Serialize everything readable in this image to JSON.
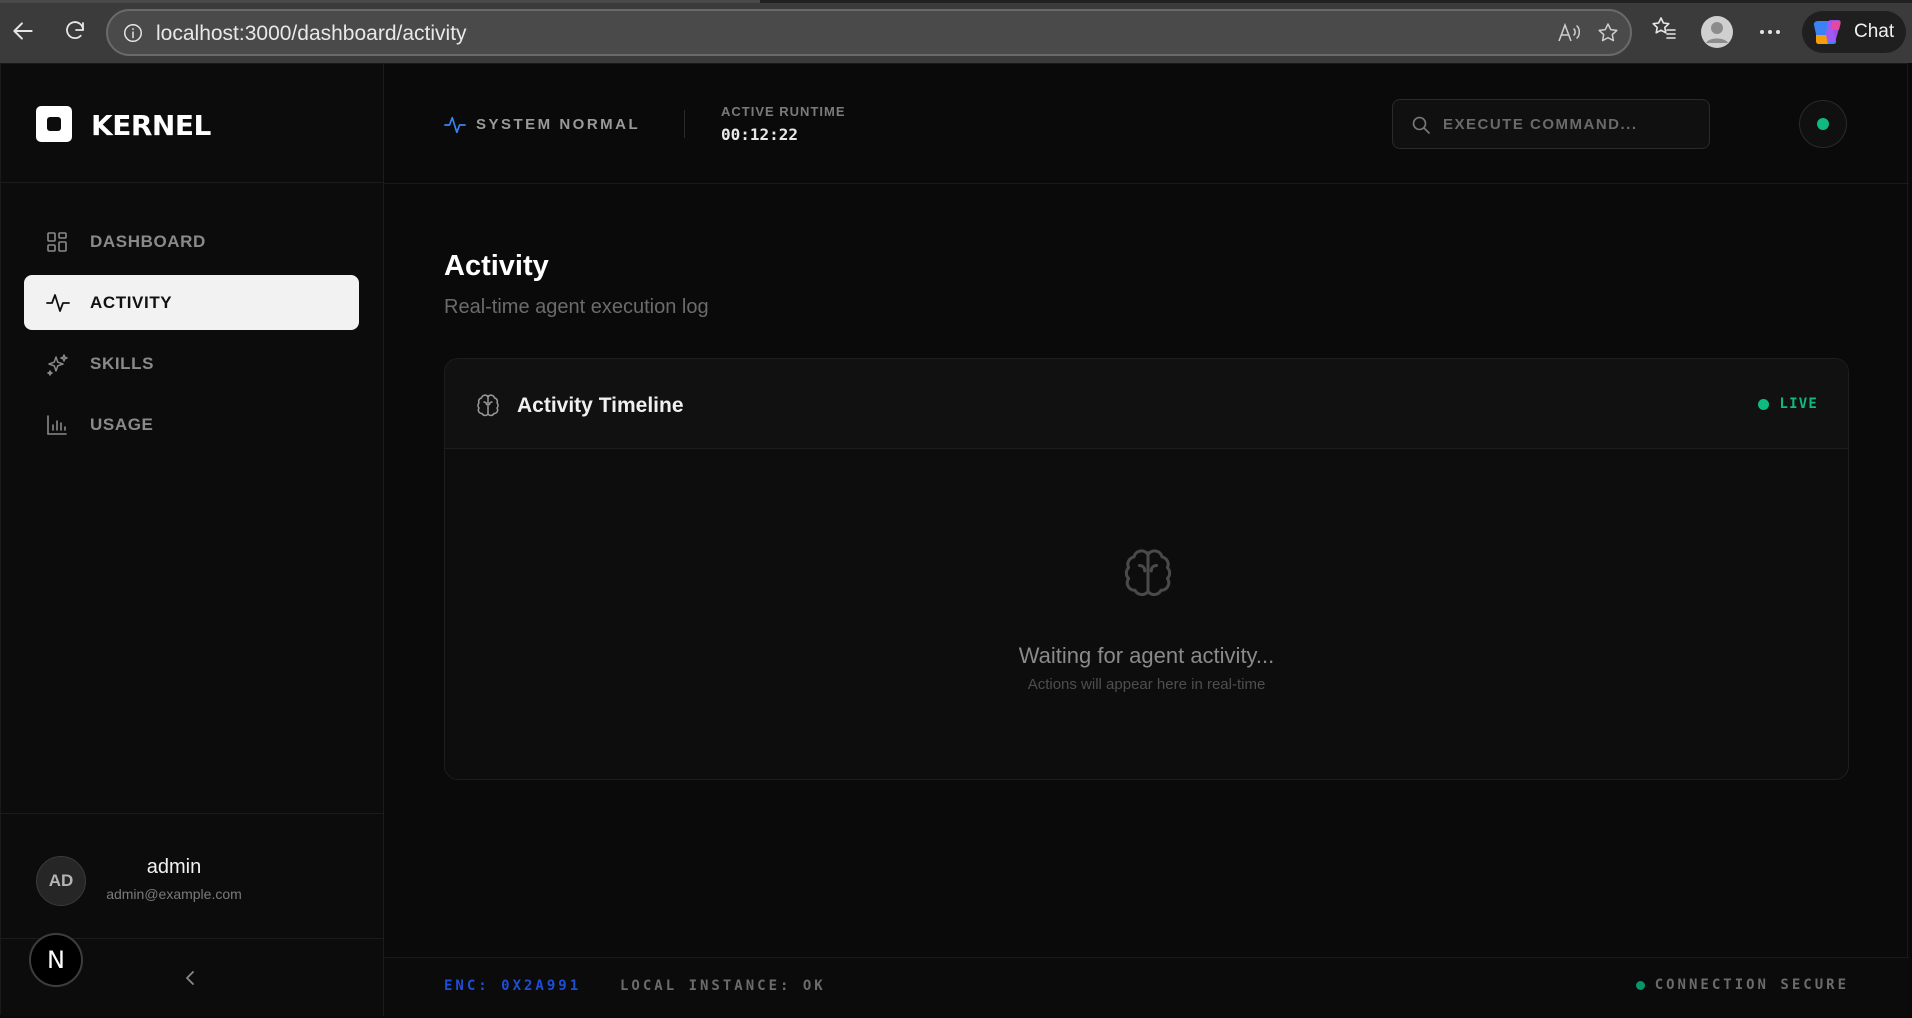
{
  "browser": {
    "url": "localhost:3000/dashboard/activity",
    "chat_label": "Chat",
    "icons": [
      "back-arrow-icon",
      "reload-icon",
      "info-icon",
      "read-aloud-icon",
      "star-icon",
      "favorites-icon",
      "profile-icon",
      "more-icon",
      "copilot-icon"
    ]
  },
  "sidebar": {
    "brand": "KERNEL",
    "items": [
      {
        "label": "DASHBOARD",
        "icon": "grid-icon",
        "active": false
      },
      {
        "label": "ACTIVITY",
        "icon": "pulse-icon",
        "active": true
      },
      {
        "label": "SKILLS",
        "icon": "sparkles-icon",
        "active": false
      },
      {
        "label": "USAGE",
        "icon": "bar-chart-icon",
        "active": false
      }
    ],
    "user": {
      "initials": "AD",
      "name": "admin",
      "email": "admin@example.com"
    },
    "next_badge": "N"
  },
  "topbar": {
    "system_status": "SYSTEM NORMAL",
    "runtime_label": "ACTIVE RUNTIME",
    "runtime_value": "00:12:22",
    "command_placeholder": "EXECUTE COMMAND..."
  },
  "page": {
    "title": "Activity",
    "subtitle": "Real-time agent execution log"
  },
  "timeline": {
    "title": "Activity Timeline",
    "live_label": "LIVE",
    "empty_message": "Waiting for agent activity...",
    "empty_sub": "Actions will appear here in real-time"
  },
  "footer": {
    "enc": "ENC: 0X2A991",
    "local": "LOCAL INSTANCE: OK",
    "secure": "CONNECTION SECURE"
  },
  "colors": {
    "accent_green": "#10b981",
    "accent_blue": "#1d4ed8",
    "background": "#0a0a0a"
  }
}
